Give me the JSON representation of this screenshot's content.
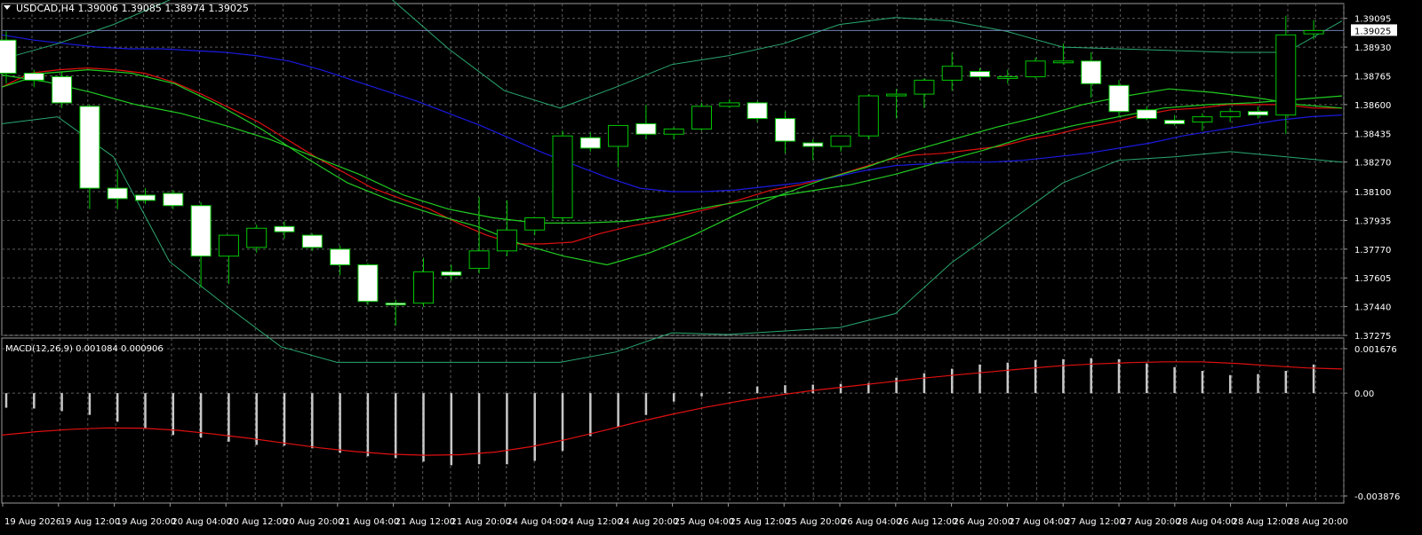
{
  "header": {
    "symbol": "USDCAD,H4",
    "ohlc": "1.39006 1.39085 1.38974 1.39025"
  },
  "macd_header": {
    "label": "MACD(12,26,9)",
    "values": "0.001084 0.000906"
  },
  "current_price_label": "1.39025",
  "colors": {
    "background": "#000000",
    "grid": "#5a5a5a",
    "bull_candle": "#00c800",
    "bear_candle_fill": "#ffffff",
    "ma_red": "#e01010",
    "ma_blue": "#1a1ae0",
    "ma_green": "#22cc22",
    "bands": "#2aa870",
    "macd_hist": "#c8c8c8",
    "macd_signal": "#e01010",
    "price_line": "#7080b0"
  },
  "chart_data": [
    {
      "type": "candlestick",
      "title": "USDCAD,H4",
      "ylim": [
        1.37275,
        1.3918
      ],
      "y_ticks": [
        "1.39095",
        "1.38930",
        "1.38765",
        "1.38600",
        "1.38435",
        "1.38270",
        "1.38100",
        "1.37935",
        "1.37770",
        "1.37605",
        "1.37440",
        "1.37275"
      ],
      "x_ticks": [
        "19 Aug 2026",
        "19 Aug 12:00",
        "19 Aug 20:00",
        "20 Aug 04:00",
        "20 Aug 12:00",
        "20 Aug 20:00",
        "21 Aug 04:00",
        "21 Aug 12:00",
        "21 Aug 20:00",
        "24 Aug 04:00",
        "24 Aug 12:00",
        "24 Aug 20:00",
        "25 Aug 04:00",
        "25 Aug 12:00",
        "25 Aug 20:00",
        "26 Aug 04:00",
        "26 Aug 12:00",
        "26 Aug 20:00",
        "27 Aug 04:00",
        "27 Aug 12:00",
        "27 Aug 20:00",
        "28 Aug 04:00",
        "28 Aug 12:00",
        "28 Aug 20:00"
      ],
      "candles": [
        {
          "o": 1.3897,
          "h": 1.3902,
          "l": 1.3872,
          "c": 1.3878
        },
        {
          "o": 1.3878,
          "h": 1.388,
          "l": 1.387,
          "c": 1.3874
        },
        {
          "o": 1.3876,
          "h": 1.3879,
          "l": 1.3858,
          "c": 1.3861
        },
        {
          "o": 1.3859,
          "h": 1.386,
          "l": 1.38,
          "c": 1.3812
        },
        {
          "o": 1.3812,
          "h": 1.3823,
          "l": 1.38,
          "c": 1.3806
        },
        {
          "o": 1.3808,
          "h": 1.3812,
          "l": 1.3803,
          "c": 1.3805
        },
        {
          "o": 1.3809,
          "h": 1.3811,
          "l": 1.38,
          "c": 1.3802
        },
        {
          "o": 1.3802,
          "h": 1.3804,
          "l": 1.3755,
          "c": 1.3773
        },
        {
          "o": 1.3773,
          "h": 1.3783,
          "l": 1.3757,
          "c": 1.3785
        },
        {
          "o": 1.3778,
          "h": 1.3791,
          "l": 1.3775,
          "c": 1.3789
        },
        {
          "o": 1.379,
          "h": 1.3793,
          "l": 1.3783,
          "c": 1.3787
        },
        {
          "o": 1.3785,
          "h": 1.3786,
          "l": 1.3776,
          "c": 1.3778
        },
        {
          "o": 1.3777,
          "h": 1.3779,
          "l": 1.3762,
          "c": 1.3768
        },
        {
          "o": 1.3768,
          "h": 1.3769,
          "l": 1.3745,
          "c": 1.3747
        },
        {
          "o": 1.3746,
          "h": 1.3748,
          "l": 1.3733,
          "c": 1.3745
        },
        {
          "o": 1.3746,
          "h": 1.3772,
          "l": 1.3744,
          "c": 1.3764
        },
        {
          "o": 1.3764,
          "h": 1.3768,
          "l": 1.3759,
          "c": 1.3762
        },
        {
          "o": 1.3766,
          "h": 1.3807,
          "l": 1.3763,
          "c": 1.3776
        },
        {
          "o": 1.3776,
          "h": 1.3805,
          "l": 1.3773,
          "c": 1.3788
        },
        {
          "o": 1.3788,
          "h": 1.3795,
          "l": 1.3785,
          "c": 1.3795
        },
        {
          "o": 1.3795,
          "h": 1.3845,
          "l": 1.3793,
          "c": 1.3842
        },
        {
          "o": 1.3841,
          "h": 1.3844,
          "l": 1.3833,
          "c": 1.3835
        },
        {
          "o": 1.3836,
          "h": 1.3848,
          "l": 1.3824,
          "c": 1.3848
        },
        {
          "o": 1.3849,
          "h": 1.386,
          "l": 1.384,
          "c": 1.3843
        },
        {
          "o": 1.3843,
          "h": 1.3847,
          "l": 1.384,
          "c": 1.3846
        },
        {
          "o": 1.3846,
          "h": 1.3861,
          "l": 1.3845,
          "c": 1.3859
        },
        {
          "o": 1.3859,
          "h": 1.3863,
          "l": 1.3858,
          "c": 1.3861
        },
        {
          "o": 1.3861,
          "h": 1.3862,
          "l": 1.385,
          "c": 1.3852
        },
        {
          "o": 1.3852,
          "h": 1.3856,
          "l": 1.3832,
          "c": 1.3839
        },
        {
          "o": 1.3838,
          "h": 1.384,
          "l": 1.3828,
          "c": 1.3836
        },
        {
          "o": 1.3836,
          "h": 1.3842,
          "l": 1.3833,
          "c": 1.3842
        },
        {
          "o": 1.3842,
          "h": 1.3866,
          "l": 1.384,
          "c": 1.3865
        },
        {
          "o": 1.3865,
          "h": 1.3869,
          "l": 1.3852,
          "c": 1.3866
        },
        {
          "o": 1.3866,
          "h": 1.3875,
          "l": 1.3858,
          "c": 1.3874
        },
        {
          "o": 1.3874,
          "h": 1.389,
          "l": 1.3868,
          "c": 1.3882
        },
        {
          "o": 1.3879,
          "h": 1.3881,
          "l": 1.3874,
          "c": 1.3876
        },
        {
          "o": 1.3875,
          "h": 1.388,
          "l": 1.3872,
          "c": 1.3876
        },
        {
          "o": 1.3876,
          "h": 1.3887,
          "l": 1.3875,
          "c": 1.3885
        },
        {
          "o": 1.3884,
          "h": 1.3895,
          "l": 1.3883,
          "c": 1.3885
        },
        {
          "o": 1.3885,
          "h": 1.389,
          "l": 1.3864,
          "c": 1.3872
        },
        {
          "o": 1.3871,
          "h": 1.3874,
          "l": 1.3853,
          "c": 1.3856
        },
        {
          "o": 1.3857,
          "h": 1.3859,
          "l": 1.3851,
          "c": 1.3852
        },
        {
          "o": 1.3851,
          "h": 1.3854,
          "l": 1.3848,
          "c": 1.3849
        },
        {
          "o": 1.385,
          "h": 1.3855,
          "l": 1.3845,
          "c": 1.3853
        },
        {
          "o": 1.3853,
          "h": 1.3858,
          "l": 1.385,
          "c": 1.3856
        },
        {
          "o": 1.3856,
          "h": 1.3859,
          "l": 1.3852,
          "c": 1.3854
        },
        {
          "o": 1.3854,
          "h": 1.3911,
          "l": 1.3843,
          "c": 1.39
        },
        {
          "o": 1.39006,
          "h": 1.39085,
          "l": 1.38974,
          "c": 1.39025
        }
      ],
      "overlays": [
        {
          "color": "ma_red",
          "values": [
            1.387,
            1.3878,
            1.388,
            1.3881,
            1.388,
            1.3878,
            1.3873,
            1.3866,
            1.3858,
            1.385,
            1.384,
            1.383,
            1.3821,
            1.3812,
            1.3806,
            1.38,
            1.3792,
            1.3785,
            1.378,
            1.378,
            1.3781,
            1.3786,
            1.379,
            1.3793,
            1.3797,
            1.3801,
            1.3806,
            1.3811,
            1.3814,
            1.3818,
            1.3823,
            1.3828,
            1.3831,
            1.3832,
            1.3834,
            1.3836,
            1.384,
            1.3843,
            1.3847,
            1.385,
            1.3854,
            1.3857,
            1.3858,
            1.386,
            1.386,
            1.386,
            1.3858,
            1.3858
          ]
        },
        {
          "color": "ma_blue",
          "values": [
            1.39,
            1.3897,
            1.3895,
            1.3893,
            1.3892,
            1.3892,
            1.3891,
            1.389,
            1.3888,
            1.3885,
            1.388,
            1.3874,
            1.3868,
            1.3862,
            1.3855,
            1.3848,
            1.384,
            1.3832,
            1.3825,
            1.3818,
            1.3812,
            1.381,
            1.381,
            1.3811,
            1.3813,
            1.3815,
            1.3818,
            1.3822,
            1.3825,
            1.3826,
            1.3827,
            1.3827,
            1.3828,
            1.383,
            1.3832,
            1.3835,
            1.3838,
            1.3842,
            1.3845,
            1.3848,
            1.3851,
            1.3853,
            1.3854
          ]
        },
        {
          "color": "ma_green",
          "values": [
            1.387,
            1.3878,
            1.388,
            1.3878,
            1.3872,
            1.386,
            1.3846,
            1.383,
            1.3815,
            1.3805,
            1.3797,
            1.379,
            1.378,
            1.3773,
            1.3768,
            1.3775,
            1.3785,
            1.3797,
            1.3808,
            1.3817,
            1.3824,
            1.3833,
            1.384,
            1.3847,
            1.3853,
            1.386,
            1.3865,
            1.3869,
            1.3867,
            1.3864,
            1.386,
            1.3858
          ]
        },
        {
          "color": "ma_green",
          "values": [
            1.3877,
            1.3873,
            1.3867,
            1.386,
            1.3855,
            1.3848,
            1.384,
            1.383,
            1.382,
            1.3808,
            1.38,
            1.3795,
            1.3792,
            1.3792,
            1.3793,
            1.3797,
            1.3802,
            1.3806,
            1.381,
            1.3814,
            1.382,
            1.3827,
            1.3834,
            1.3842,
            1.3848,
            1.3853,
            1.3858,
            1.386,
            1.3861,
            1.3863,
            1.3865
          ]
        },
        {
          "color": "bands",
          "values": [
            1.3886,
            1.3895,
            1.3906,
            1.392,
            1.3938,
            1.395,
            1.3945,
            1.392,
            1.3892,
            1.3868,
            1.3858,
            1.387,
            1.3883,
            1.3888,
            1.3895,
            1.3906,
            1.391,
            1.3908,
            1.3902,
            1.3893,
            1.3892,
            1.3891,
            1.389,
            1.389,
            1.3908
          ]
        },
        {
          "color": "bands",
          "values": [
            1.3849,
            1.3853,
            1.383,
            1.377,
            1.3745,
            1.3721,
            1.3712,
            1.3712,
            1.3712,
            1.3712,
            1.3712,
            1.3718,
            1.3729,
            1.3728,
            1.373,
            1.3732,
            1.374,
            1.3769,
            1.3792,
            1.3815,
            1.3828,
            1.383,
            1.3833,
            1.383,
            1.3827
          ]
        }
      ]
    },
    {
      "type": "bar",
      "title": "MACD(12,26,9)",
      "ylim": [
        -0.003876,
        0.001676
      ],
      "y_ticks": [
        "0.001676",
        "0.00",
        "-0.003876"
      ],
      "histogram": [
        -0.00055,
        -0.00058,
        -0.00068,
        -0.00082,
        -0.00108,
        -0.00135,
        -0.00158,
        -0.00168,
        -0.00183,
        -0.00195,
        -0.00198,
        -0.00208,
        -0.00225,
        -0.00238,
        -0.00245,
        -0.00258,
        -0.00272,
        -0.00268,
        -0.00268,
        -0.00255,
        -0.00218,
        -0.00162,
        -0.00128,
        -0.00082,
        -0.00032,
        -0.00012,
        3e-05,
        0.00025,
        0.0003,
        0.00032,
        0.00035,
        0.00038,
        0.00058,
        0.00075,
        0.00092,
        0.00108,
        0.00115,
        0.00125,
        0.00128,
        0.00132,
        0.00128,
        0.00112,
        0.00098,
        0.00084,
        0.00068,
        0.00072,
        0.00084,
        0.00108
      ],
      "signal": [
        -0.00158,
        -0.00145,
        -0.00136,
        -0.00131,
        -0.00132,
        -0.0014,
        -0.00154,
        -0.0017,
        -0.00188,
        -0.00206,
        -0.0022,
        -0.0023,
        -0.00234,
        -0.00232,
        -0.00222,
        -0.00202,
        -0.00175,
        -0.00143,
        -0.0011,
        -0.0008,
        -0.00052,
        -0.00028,
        -8e-05,
        0.0001,
        0.00025,
        0.0004,
        0.00055,
        0.00068,
        0.0008,
        0.00092,
        0.00103,
        0.0011,
        0.00115,
        0.00118,
        0.00118,
        0.00112,
        0.00103,
        0.00095,
        0.00091
      ]
    }
  ]
}
